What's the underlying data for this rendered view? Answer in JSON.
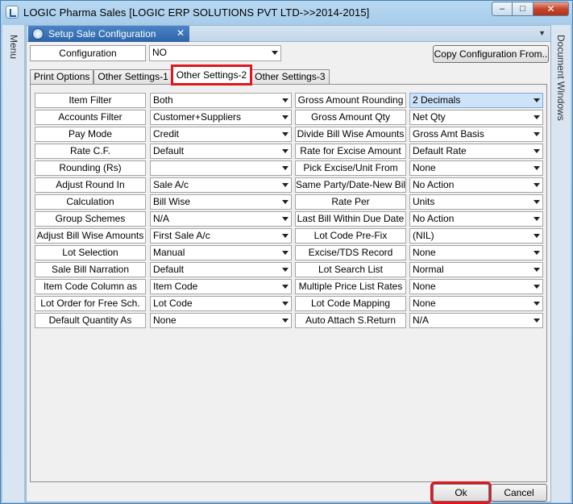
{
  "window": {
    "title": "LOGIC Pharma Sales  [LOGIC ERP SOLUTIONS PVT LTD->>2014-2015]",
    "controls": {
      "minimize": "–",
      "maximize": "□",
      "close": "✕"
    }
  },
  "sidebars": {
    "left": "Menu",
    "right": "Document Windows"
  },
  "doc_tab": {
    "title": "Setup Sale Configuration",
    "close": "✕"
  },
  "configuration": {
    "label": "Configuration",
    "value": "NO",
    "copy_button": "Copy  Configuration From.."
  },
  "tabs": [
    "Print Options",
    "Other Settings-1",
    "Other Settings-2",
    "Other Settings-3"
  ],
  "active_tab": "Other Settings-2",
  "left_settings": [
    {
      "label": "Item Filter",
      "value": "Both"
    },
    {
      "label": "Accounts Filter",
      "value": "Customer+Suppliers"
    },
    {
      "label": "Pay Mode",
      "value": "Credit"
    },
    {
      "label": "Rate C.F.",
      "value": "Default"
    },
    {
      "label": "Rounding  (Rs)",
      "value": ""
    },
    {
      "label": "Adjust Round In",
      "value": "Sale A/c"
    },
    {
      "label": "Calculation",
      "value": "Bill Wise"
    },
    {
      "label": "Group Schemes",
      "value": "N/A"
    },
    {
      "label": "Adjust Bill Wise Amounts",
      "value": "First Sale A/c"
    },
    {
      "label": "Lot Selection",
      "value": "Manual"
    },
    {
      "label": "Sale Bill Narration",
      "value": "Default"
    },
    {
      "label": "Item Code Column as",
      "value": "Item Code"
    },
    {
      "label": "Lot Order for Free Sch.",
      "value": "Lot Code"
    },
    {
      "label": "Default Quantity As",
      "value": "None"
    }
  ],
  "right_settings": [
    {
      "label": "Gross Amount Rounding",
      "value": "2 Decimals"
    },
    {
      "label": "Gross Amount Qty",
      "value": "Net Qty"
    },
    {
      "label": "Divide Bill Wise Amounts",
      "value": "Gross Amt Basis"
    },
    {
      "label": "Rate for Excise Amount",
      "value": "Default Rate"
    },
    {
      "label": "Pick Excise/Unit From",
      "value": "None"
    },
    {
      "label": "Same Party/Date-New Bill",
      "value": "No Action"
    },
    {
      "label": "Rate Per",
      "value": "Units"
    },
    {
      "label": "Last Bill Within Due Date",
      "value": "No Action"
    },
    {
      "label": "Lot Code Pre-Fix",
      "value": "(NIL)"
    },
    {
      "label": "Excise/TDS Record",
      "value": "None"
    },
    {
      "label": "Lot Search List",
      "value": "Normal"
    },
    {
      "label": "Multiple Price List Rates",
      "value": "None"
    },
    {
      "label": "Lot Code Mapping",
      "value": "None"
    },
    {
      "label": "Auto Attach S.Return",
      "value": "N/A"
    }
  ],
  "buttons": {
    "ok": "Ok",
    "cancel": "Cancel"
  },
  "colors": {
    "highlight_red": "#e0151d",
    "tab_blue": "#2d64a8",
    "selected_field": "#cde3f8"
  }
}
